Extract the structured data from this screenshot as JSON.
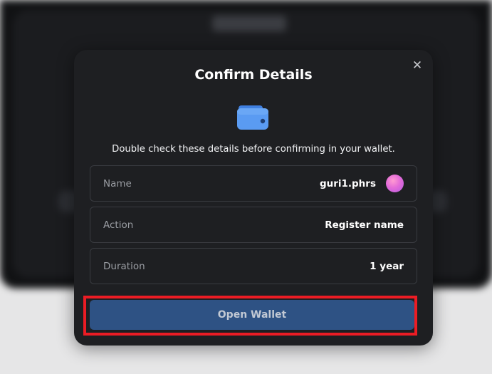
{
  "dialog": {
    "title": "Confirm Details",
    "close_symbol": "✕",
    "icon": "wallet-icon",
    "subtitle": "Double check these details before confirming in your wallet.",
    "rows": [
      {
        "label": "Name",
        "value": "guri1.phrs",
        "has_avatar": true
      },
      {
        "label": "Action",
        "value": "Register name"
      },
      {
        "label": "Duration",
        "value": "1 year"
      }
    ],
    "open_button_label": "Open Wallet"
  },
  "colors": {
    "dialog_bg": "#1e1f22",
    "button_bg": "#2e5284",
    "highlight": "#ec1c24",
    "wallet_blue": "#4b8df0",
    "avatar_pink": "#e46bd8"
  }
}
